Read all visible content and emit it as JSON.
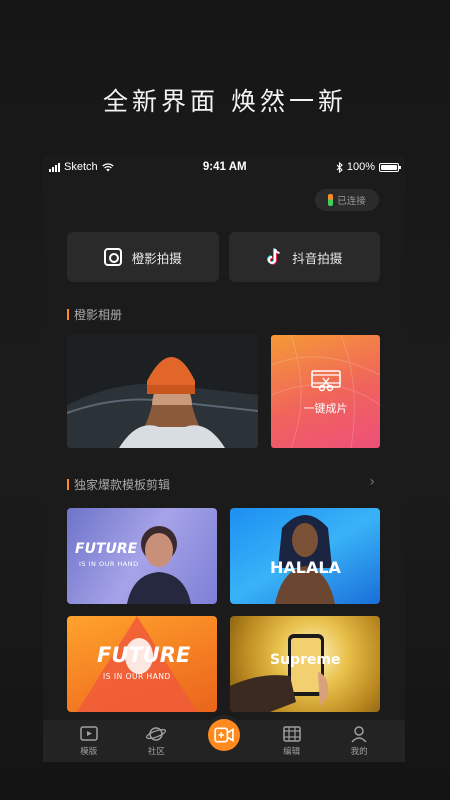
{
  "headline": "全新界面 焕然一新",
  "status_bar": {
    "carrier": "Sketch",
    "time": "9:41 AM",
    "battery": "100%"
  },
  "connection_badge": "已连接",
  "shoot_buttons": [
    {
      "label": "橙影拍摄",
      "icon": "camera-icon"
    },
    {
      "label": "抖音拍摄",
      "icon": "tiktok-icon"
    }
  ],
  "album_section": {
    "title": "橙影相册",
    "oneclick_label": "一键成片"
  },
  "template_section": {
    "title": "独家爆款模板剪辑",
    "templates": [
      {
        "title": "FUTURE",
        "subtitle": "IS IN OUR HAND"
      },
      {
        "title": "HALALA"
      },
      {
        "title": "FUTURE",
        "subtitle": "IS IN OUR HAND"
      },
      {
        "title": "Supreme"
      }
    ]
  },
  "tabbar": [
    {
      "label": "模版",
      "icon": "template-icon"
    },
    {
      "label": "社区",
      "icon": "planet-icon"
    },
    {
      "label": "",
      "icon": "add-video-icon"
    },
    {
      "label": "编辑",
      "icon": "film-icon"
    },
    {
      "label": "我的",
      "icon": "user-icon"
    }
  ],
  "colors": {
    "accent": "#ff8a1f",
    "background": "#1b1b1b",
    "card": "#2a2a2a"
  }
}
